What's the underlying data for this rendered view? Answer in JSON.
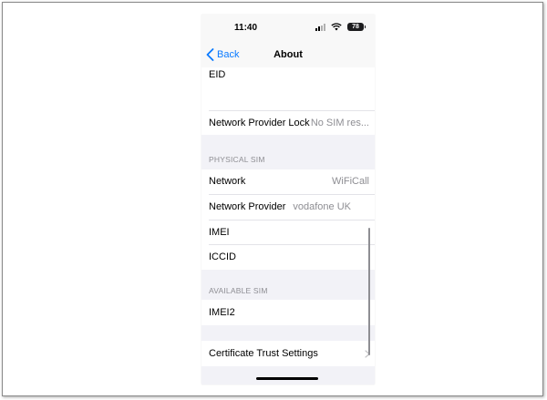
{
  "status_bar": {
    "time": "11:40",
    "battery": "78"
  },
  "nav": {
    "back_label": "Back",
    "title": "About"
  },
  "rows": {
    "eid": {
      "label": "EID"
    },
    "network_provider_lock": {
      "label": "Network Provider Lock",
      "value": "No SIM res..."
    },
    "network": {
      "label": "Network",
      "value": "WiFiCall"
    },
    "network_provider": {
      "label": "Network Provider",
      "value": "vodafone UK"
    },
    "imei": {
      "label": "IMEI"
    },
    "iccid": {
      "label": "ICCID"
    },
    "imei2": {
      "label": "IMEI2"
    },
    "certificate_trust": {
      "label": "Certificate Trust Settings"
    }
  },
  "sections": {
    "physical_sim": "PHYSICAL SIM",
    "available_sim": "AVAILABLE SIM"
  },
  "colors": {
    "accent": "#0a7aff",
    "background": "#f2f2f7",
    "secondary_text": "#8e8e93"
  }
}
